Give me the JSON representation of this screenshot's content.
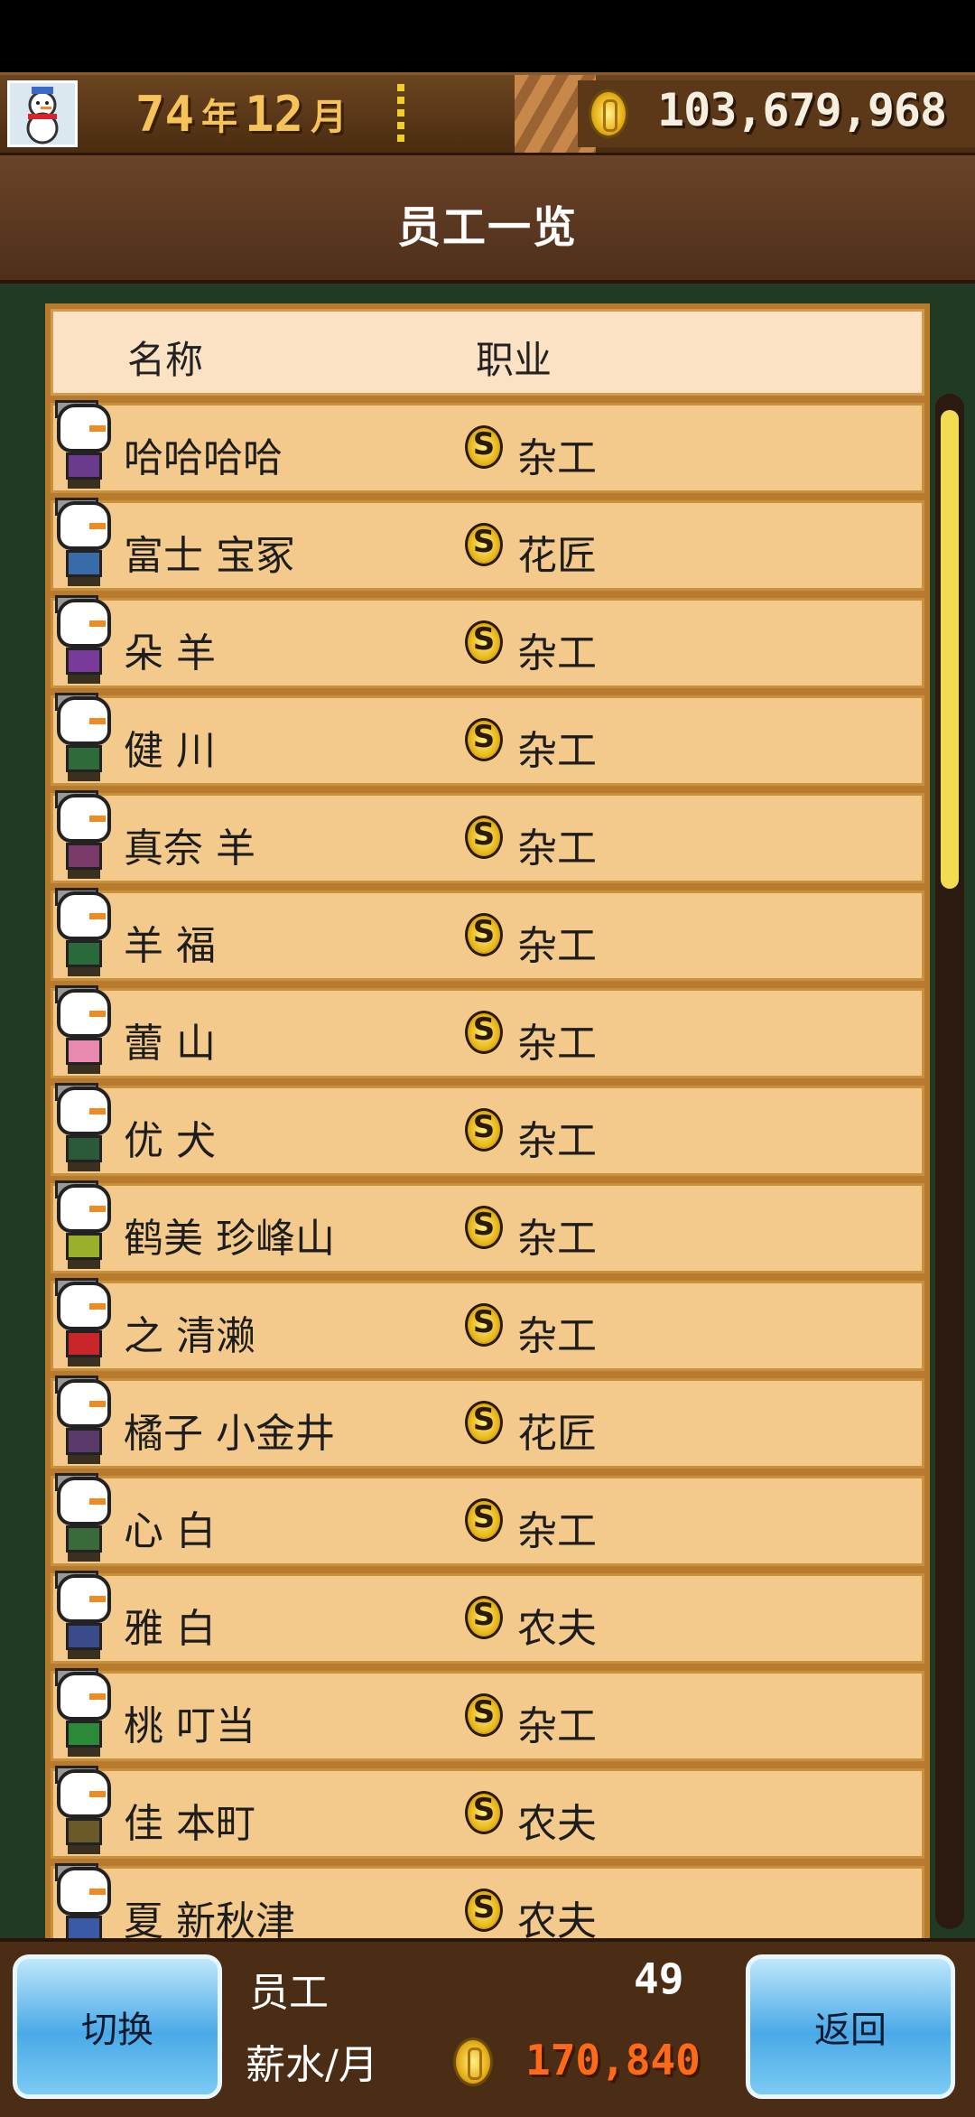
{
  "header": {
    "year": "74",
    "year_label": "年",
    "month": "12",
    "month_label": "月",
    "money": "103,679,968"
  },
  "title": "员工一览",
  "table": {
    "col_name": "名称",
    "col_job": "职业",
    "rows": [
      {
        "name": "哈哈哈哈",
        "job": "杂工",
        "color": "#6a3a8c"
      },
      {
        "name": "富士 宝冢",
        "job": "花匠",
        "color": "#3a6aa8"
      },
      {
        "name": "朵 羊",
        "job": "杂工",
        "color": "#7a3a9a"
      },
      {
        "name": "健 川",
        "job": "杂工",
        "color": "#2f6a3a"
      },
      {
        "name": "真奈 羊",
        "job": "杂工",
        "color": "#7a3a6a"
      },
      {
        "name": "羊 福",
        "job": "杂工",
        "color": "#2a6a3a"
      },
      {
        "name": "蕾 山",
        "job": "杂工",
        "color": "#e88ab0"
      },
      {
        "name": "优 犬",
        "job": "杂工",
        "color": "#2a5a3a"
      },
      {
        "name": "鹤美 珍峰山",
        "job": "杂工",
        "color": "#9ab02a"
      },
      {
        "name": "之 清濑",
        "job": "杂工",
        "color": "#c8262a"
      },
      {
        "name": "橘子 小金井",
        "job": "花匠",
        "color": "#5a3a6a"
      },
      {
        "name": "心 白",
        "job": "杂工",
        "color": "#3a6a3a"
      },
      {
        "name": "雅 白",
        "job": "农夫",
        "color": "#3a4a8a"
      },
      {
        "name": "桃 叮当",
        "job": "杂工",
        "color": "#2a8a3a"
      },
      {
        "name": "佳 本町",
        "job": "农夫",
        "color": "#6a5a2a"
      },
      {
        "name": "夏 新秋津",
        "job": "农夫",
        "color": "#3a5aa8"
      }
    ]
  },
  "job_coin_symbol": "S",
  "footer": {
    "switch_label": "切换",
    "back_label": "返回",
    "staff_label": "员工",
    "staff_count": "49",
    "salary_label": "薪水/月",
    "salary_value": "170,840"
  }
}
